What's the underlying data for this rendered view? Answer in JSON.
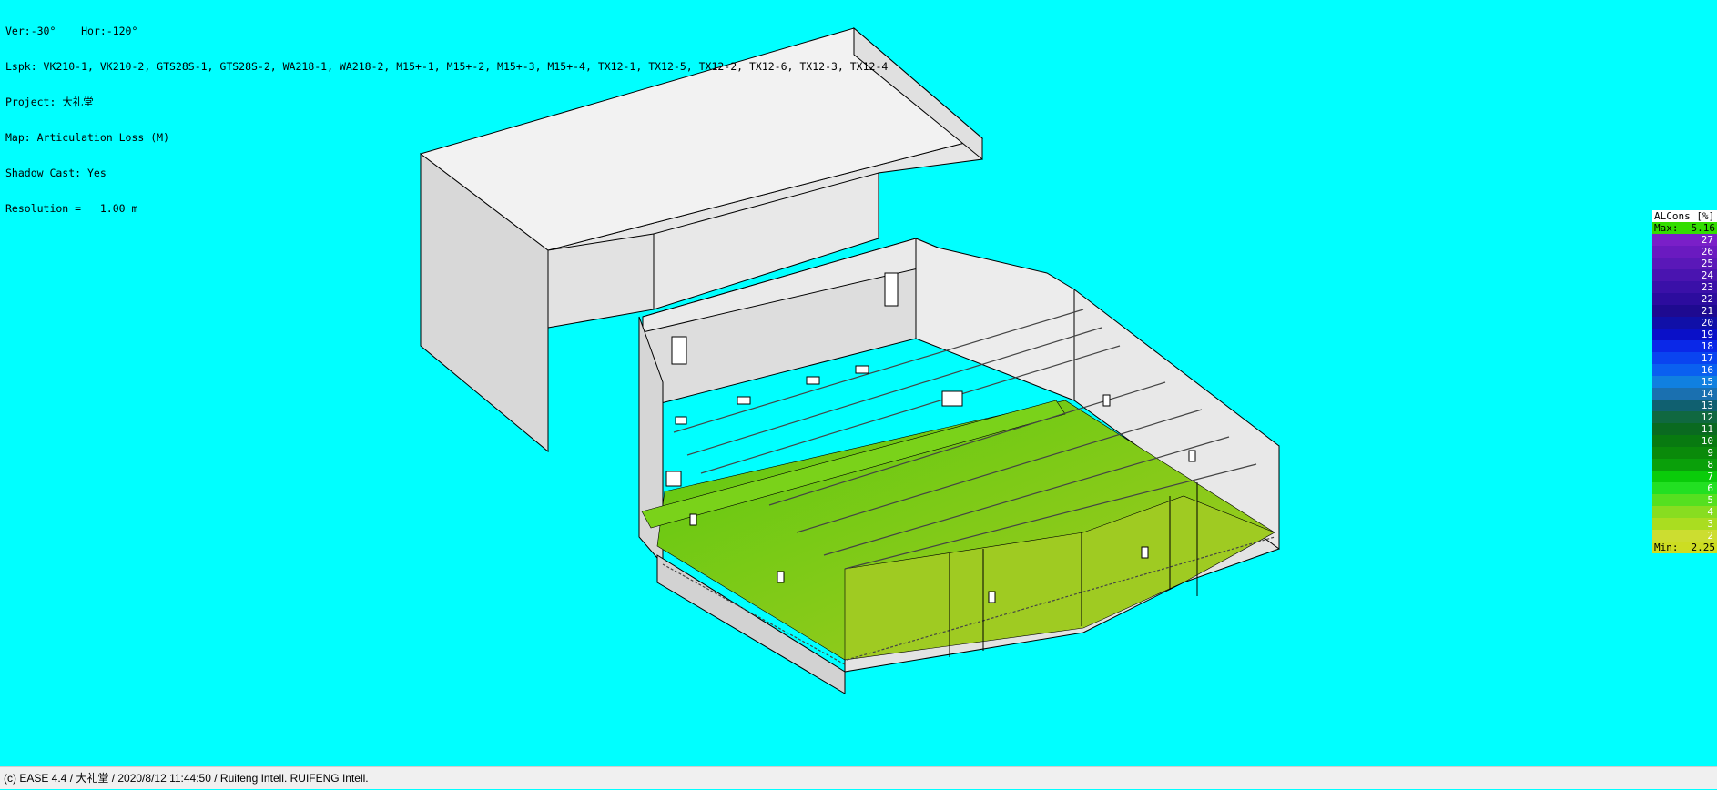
{
  "info": {
    "view_angles": "Ver:-30°    Hor:-120°",
    "loudspeakers": "Lspk: VK210-1, VK210-2, GTS28S-1, GTS28S-2, WA218-1, WA218-2, M15+-1, M15+-2, M15+-3, M15+-4, TX12-1, TX12-5, TX12-2, TX12-6, TX12-3, TX12-4",
    "project": "Project: 大礼堂",
    "map": "Map: Articulation Loss (M)",
    "shadow": "Shadow Cast: Yes",
    "resolution": "Resolution =   1.00 m"
  },
  "legend": {
    "title": "ALCons [%]",
    "max_label": "Max:",
    "max_value": "5.16",
    "max_color": "#33DD00",
    "min_label": "Min:",
    "min_value": "2.25",
    "min_color": "#CCDD22",
    "scale": [
      {
        "label": "27",
        "color": "#7A1FC8"
      },
      {
        "label": "26",
        "color": "#6A1AC0"
      },
      {
        "label": "25",
        "color": "#5A18B8"
      },
      {
        "label": "24",
        "color": "#4A14B0"
      },
      {
        "label": "23",
        "color": "#3A10A8"
      },
      {
        "label": "22",
        "color": "#2C0C9E"
      },
      {
        "label": "21",
        "color": "#1E0A90"
      },
      {
        "label": "20",
        "color": "#1010A8"
      },
      {
        "label": "19",
        "color": "#0A10C8"
      },
      {
        "label": "18",
        "color": "#0A28E8"
      },
      {
        "label": "17",
        "color": "#0A44F0"
      },
      {
        "label": "16",
        "color": "#0A60F0"
      },
      {
        "label": "15",
        "color": "#1080E0"
      },
      {
        "label": "14",
        "color": "#1A70B0"
      },
      {
        "label": "13",
        "color": "#106070"
      },
      {
        "label": "12",
        "color": "#106840"
      },
      {
        "label": "11",
        "color": "#0A6A20"
      },
      {
        "label": "10",
        "color": "#087A10"
      },
      {
        "label": "9",
        "color": "#0A8A0A"
      },
      {
        "label": "8",
        "color": "#0AA00A"
      },
      {
        "label": "7",
        "color": "#0ACC0A"
      },
      {
        "label": "6",
        "color": "#22E022"
      },
      {
        "label": "5",
        "color": "#55E020"
      },
      {
        "label": "4",
        "color": "#88DD20"
      },
      {
        "label": "3",
        "color": "#AADD20"
      },
      {
        "label": "2",
        "color": "#CCDD30"
      }
    ]
  },
  "scene": {
    "floor_colors": {
      "high": "#5CC810",
      "low": "#A8CC20"
    },
    "wall_color": "#DADADA",
    "outline_color": "#000000"
  },
  "status_bar": {
    "text": "(c) EASE 4.4  / 大礼堂  / 2020/8/12 11:44:50 / Ruifeng Intell. RUIFENG Intell."
  }
}
